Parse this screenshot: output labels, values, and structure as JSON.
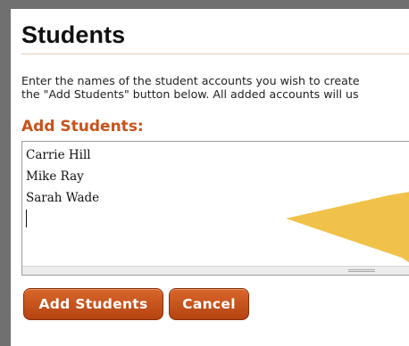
{
  "page": {
    "title": "Students",
    "instructions_line1": "Enter the names of the student accounts you wish to create",
    "instructions_line2": "the \"Add Students\" button below. All added accounts will us"
  },
  "form": {
    "section_label": "Add Students:",
    "student_names": [
      "Carrie Hill",
      "Mike Ray",
      "Sarah Wade"
    ]
  },
  "buttons": {
    "add_label": "Add Students",
    "cancel_label": "Cancel"
  },
  "colors": {
    "accent": "#c9511a",
    "button": "#c4501b",
    "pointer": "#f0c24a",
    "frame": "#707070"
  },
  "icons": {
    "pointer": "yellow-arrow-pointer"
  }
}
